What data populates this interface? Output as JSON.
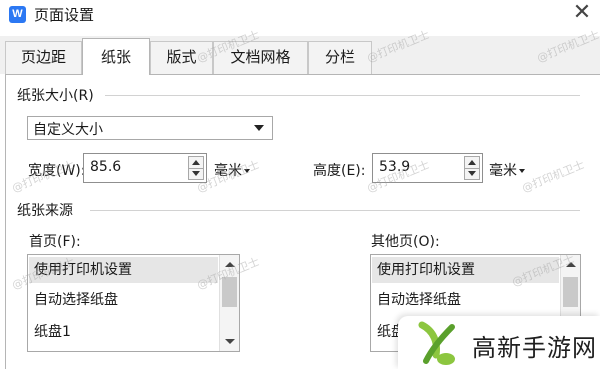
{
  "window": {
    "title": "页面设置",
    "app_icon_letter": "W"
  },
  "tabs": [
    {
      "label": "页边距"
    },
    {
      "label": "纸张"
    },
    {
      "label": "版式"
    },
    {
      "label": "文档网格"
    },
    {
      "label": "分栏"
    }
  ],
  "paper_size": {
    "section_title": "纸张大小(R)",
    "dropdown_value": "自定义大小",
    "width_label": "宽度(W):",
    "width_value": "85.6",
    "width_unit": "毫米",
    "height_label": "高度(E):",
    "height_value": "53.9",
    "height_unit": "毫米"
  },
  "paper_source": {
    "section_title": "纸张来源",
    "first_page_label": "首页(F):",
    "first_page_items": [
      "使用打印机设置",
      "自动选择纸盘",
      "纸盘1"
    ],
    "other_pages_label": "其他页(O):",
    "other_pages_items": [
      "使用打印机设置",
      "自动选择纸盘",
      "纸盘"
    ]
  },
  "watermark_text": "@打印机卫士",
  "logo": {
    "text": "高新手游网"
  },
  "colors": {
    "app_icon": "#2b78f3",
    "logo_green": "#8cc63f"
  }
}
